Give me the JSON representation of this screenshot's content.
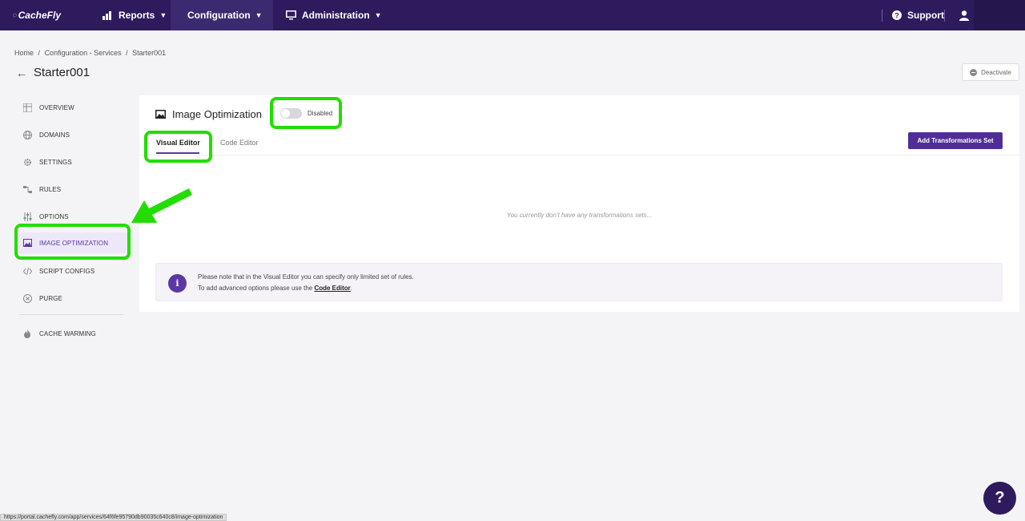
{
  "nav": {
    "logo_text": "CacheFly",
    "reports_label": "Reports",
    "configuration_label": "Configuration",
    "administration_label": "Administration",
    "support_label": "Support"
  },
  "breadcrumb": {
    "home": "Home",
    "sep1": "/",
    "services": "Configuration - Services",
    "sep2": "/",
    "current": "Starter001"
  },
  "page": {
    "title": "Starter001",
    "deactivate_label": "Deactivate"
  },
  "sidebar": {
    "items": [
      {
        "label": "OVERVIEW",
        "icon": "grid-icon"
      },
      {
        "label": "DOMAINS",
        "icon": "globe-icon"
      },
      {
        "label": "SETTINGS",
        "icon": "gear-icon"
      },
      {
        "label": "RULES",
        "icon": "flow-icon"
      },
      {
        "label": "OPTIONS",
        "icon": "sliders-icon"
      },
      {
        "label": "IMAGE OPTIMIZATION",
        "icon": "image-icon",
        "active": true
      },
      {
        "label": "SCRIPT CONFIGS",
        "icon": "code-icon"
      },
      {
        "label": "PURGE",
        "icon": "circle-x-icon"
      },
      {
        "label": "CACHE WARMING",
        "icon": "flame-icon"
      }
    ]
  },
  "card": {
    "title": "Image Optimization",
    "toggle_state": "Disabled",
    "tabs": [
      "Visual Editor",
      "Code Editor"
    ],
    "add_button": "Add Transformations Set",
    "empty_text": "You currently don't have any transformations sets...",
    "note_line1": "Please note that in the Visual Editor you can specify only limited set of rules.",
    "note_line2_prefix": "To add advanced options please use the ",
    "note_line2_link": "Code Editor",
    "note_line2_suffix": "."
  },
  "status_url": "https://portal.cachefly.com/app/services/64f6fe95790db90035c640c8/image-optimization",
  "help_label": "?",
  "colors": {
    "nav_bg": "#2d1b5e",
    "accent": "#5b36a5",
    "highlight": "#22dd00"
  }
}
